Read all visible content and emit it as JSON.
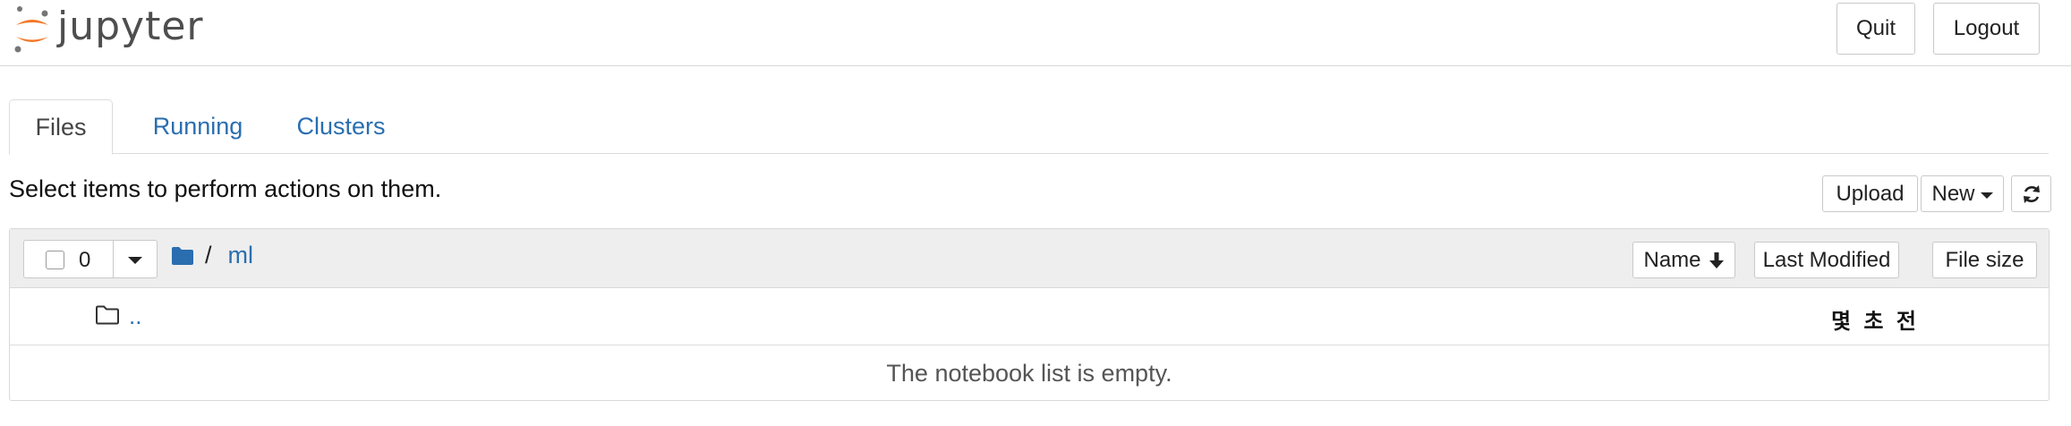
{
  "header": {
    "logo_text": "jupyter",
    "quit_label": "Quit",
    "logout_label": "Logout"
  },
  "tabs": [
    {
      "label": "Files",
      "active": true
    },
    {
      "label": "Running",
      "active": false
    },
    {
      "label": "Clusters",
      "active": false
    }
  ],
  "toolbar": {
    "hint": "Select items to perform actions on them.",
    "upload_label": "Upload",
    "new_label": "New",
    "refresh_icon": "refresh-icon"
  },
  "list": {
    "selected_count": "0",
    "breadcrumb_sep": "/",
    "current_dir": "ml",
    "sort_name_label": "Name",
    "sort_modified_label": "Last Modified",
    "sort_size_label": "File size",
    "rows": [
      {
        "name": "..",
        "modified": "몇 초 전",
        "icon": "folder-outline-icon"
      }
    ],
    "empty_message": "The notebook list is empty."
  },
  "colors": {
    "link": "#2a6eb0",
    "logo_orange": "#f37726",
    "logo_gray": "#767677",
    "header_bg": "#eeeeee"
  }
}
